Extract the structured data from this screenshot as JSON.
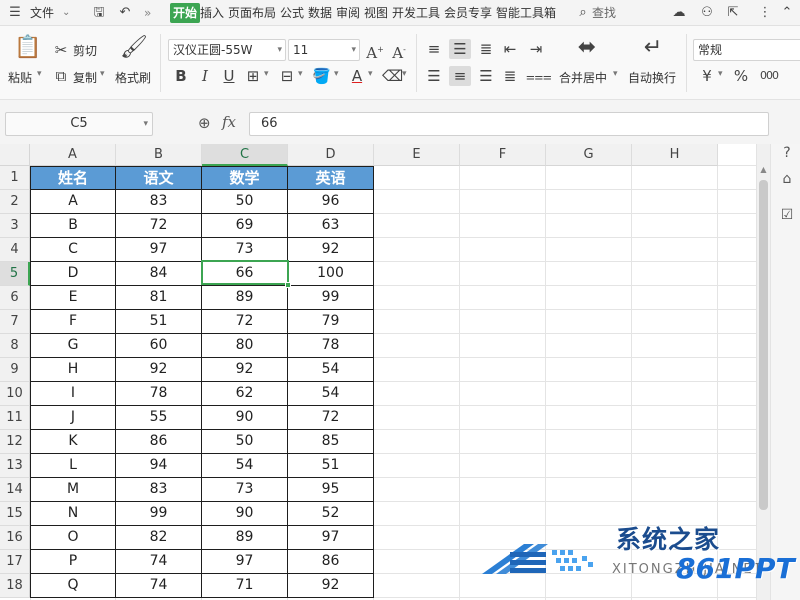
{
  "menubar": {
    "file_label": "文件",
    "tabs": [
      "开始",
      "插入",
      "页面布局",
      "公式",
      "数据",
      "审阅",
      "视图",
      "开发工具",
      "会员专享",
      "智能工具箱"
    ],
    "search_label": "查找"
  },
  "ribbon": {
    "paste_label": "粘贴",
    "cut_label": "剪切",
    "copy_label": "复制",
    "format_painter_label": "格式刷",
    "font_name": "汉仪正圆-55W",
    "font_size": "11",
    "bold_glyph": "B",
    "italic_glyph": "I",
    "underline_glyph": "U",
    "font_color_glyph": "A",
    "merge_label": "合并居中",
    "wrap_label": "自动换行",
    "number_format": "常规",
    "currency_glyph": "¥",
    "percent_glyph": "%",
    "thousands_glyph": "000"
  },
  "formula_bar": {
    "name_box": "C5",
    "fx_label": "fx",
    "formula_value": "66"
  },
  "sheet": {
    "columns": [
      "A",
      "B",
      "C",
      "D",
      "E",
      "F",
      "G",
      "H"
    ],
    "active_column": "C",
    "active_row": "5",
    "row_numbers": [
      "1",
      "2",
      "3",
      "4",
      "5",
      "6",
      "7",
      "8",
      "9",
      "10",
      "11",
      "12",
      "13",
      "14",
      "15",
      "16",
      "17",
      "18"
    ],
    "header": [
      "姓名",
      "语文",
      "数学",
      "英语"
    ],
    "rows": [
      [
        "A",
        "83",
        "50",
        "96"
      ],
      [
        "B",
        "72",
        "69",
        "63"
      ],
      [
        "C",
        "97",
        "73",
        "92"
      ],
      [
        "D",
        "84",
        "66",
        "100"
      ],
      [
        "E",
        "81",
        "89",
        "99"
      ],
      [
        "F",
        "51",
        "72",
        "79"
      ],
      [
        "G",
        "60",
        "80",
        "78"
      ],
      [
        "H",
        "92",
        "92",
        "54"
      ],
      [
        "I",
        "78",
        "62",
        "54"
      ],
      [
        "J",
        "55",
        "90",
        "72"
      ],
      [
        "K",
        "86",
        "50",
        "85"
      ],
      [
        "L",
        "94",
        "54",
        "51"
      ],
      [
        "M",
        "83",
        "73",
        "95"
      ],
      [
        "N",
        "99",
        "90",
        "52"
      ],
      [
        "O",
        "82",
        "89",
        "97"
      ],
      [
        "P",
        "74",
        "97",
        "86"
      ],
      [
        "Q",
        "74",
        "71",
        "92"
      ]
    ]
  },
  "watermark": {
    "title": "系统之家",
    "subtitle": "XITONGZHIJIA.NET",
    "brand": "861PPT"
  },
  "colors": {
    "accent": "#3ca552",
    "header_fill": "#5b9bd5",
    "header_text": "#ffffff"
  }
}
